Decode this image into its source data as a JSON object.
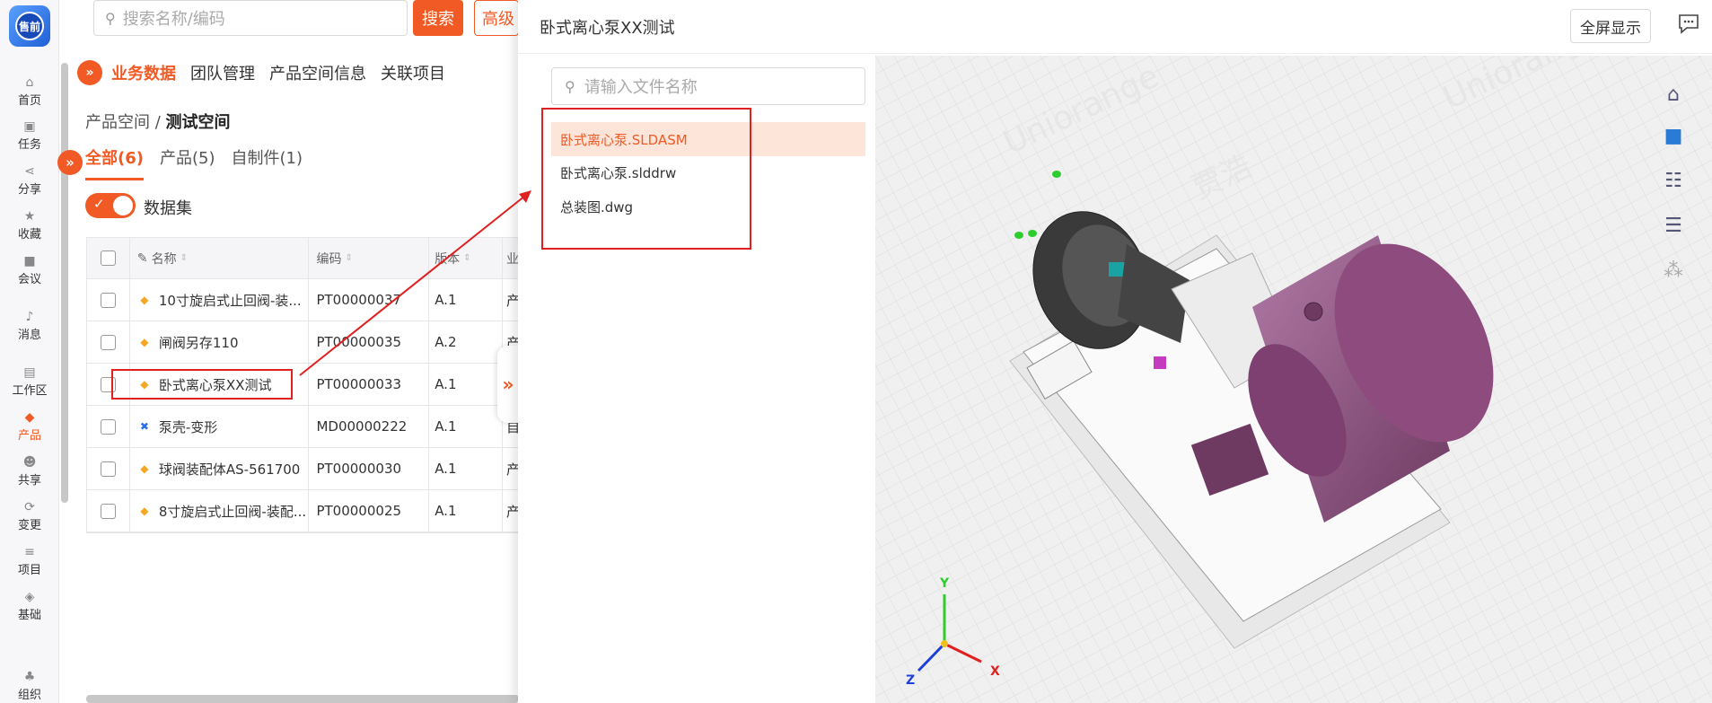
{
  "app": {
    "logo_text": "售前"
  },
  "nav": {
    "items": [
      {
        "label": "首页",
        "icon": "home-icon"
      },
      {
        "label": "任务",
        "icon": "task-icon"
      },
      {
        "label": "分享",
        "icon": "share-icon"
      },
      {
        "label": "收藏",
        "icon": "star-icon"
      },
      {
        "label": "会议",
        "icon": "video-icon"
      },
      {
        "label": "消息",
        "icon": "bell-icon"
      },
      {
        "label": "工作区",
        "icon": "workspace-icon"
      },
      {
        "label": "产品",
        "icon": "product-icon"
      },
      {
        "label": "共享",
        "icon": "users-icon"
      },
      {
        "label": "变更",
        "icon": "change-icon"
      },
      {
        "label": "项目",
        "icon": "project-icon"
      },
      {
        "label": "基础",
        "icon": "layers-icon"
      },
      {
        "label": "组织",
        "icon": "org-icon"
      }
    ]
  },
  "search": {
    "placeholder": "搜索名称/编码",
    "button": "搜索",
    "advanced": "高级"
  },
  "main_tabs": [
    "业务数据",
    "团队管理",
    "产品空间信息",
    "关联项目"
  ],
  "breadcrumb": {
    "parent": "产品空间 /",
    "current": "测试空间"
  },
  "sub_tabs": [
    "全部(6)",
    "产品(5)",
    "自制件(1)"
  ],
  "dataset_label": "数据集",
  "table": {
    "headers": [
      "名称",
      "编码",
      "版本",
      "业"
    ],
    "rows": [
      {
        "name": "10寸旋启式止回阀-装...",
        "code": "PT00000037",
        "version": "A.1",
        "extra": "产"
      },
      {
        "name": "闸阀另存110",
        "code": "PT00000035",
        "version": "A.2",
        "extra": "产"
      },
      {
        "name": "卧式离心泵XX测试",
        "code": "PT00000033",
        "version": "A.1",
        "extra": "产"
      },
      {
        "name": "泵壳-变形",
        "code": "MD00000222",
        "version": "A.1",
        "extra": "自"
      },
      {
        "name": "球阀装配体AS-561700",
        "code": "PT00000030",
        "version": "A.1",
        "extra": "产"
      },
      {
        "name": "8寸旋启式止回阀-装配...",
        "code": "PT00000025",
        "version": "A.1",
        "extra": "产"
      }
    ]
  },
  "drawer": {
    "title": "卧式离心泵XX测试",
    "fullscreen": "全屏显示",
    "file_search_placeholder": "请输入文件名称",
    "files": [
      "卧式离心泵.SLDASM",
      "卧式离心泵.slddrw",
      "总装图.dwg"
    ]
  },
  "viewer": {
    "tools": [
      "home-view-icon",
      "cube-settings-icon",
      "tree-structure-icon",
      "checklist-icon",
      "grid-icon"
    ],
    "axes": {
      "x": "X",
      "y": "Y",
      "z": "Z"
    },
    "watermarks": [
      "Uniorange",
      "贾浩"
    ]
  },
  "colors": {
    "accent": "#f15a24",
    "annotation": "#e02020",
    "motor": "#8e4b7e"
  }
}
